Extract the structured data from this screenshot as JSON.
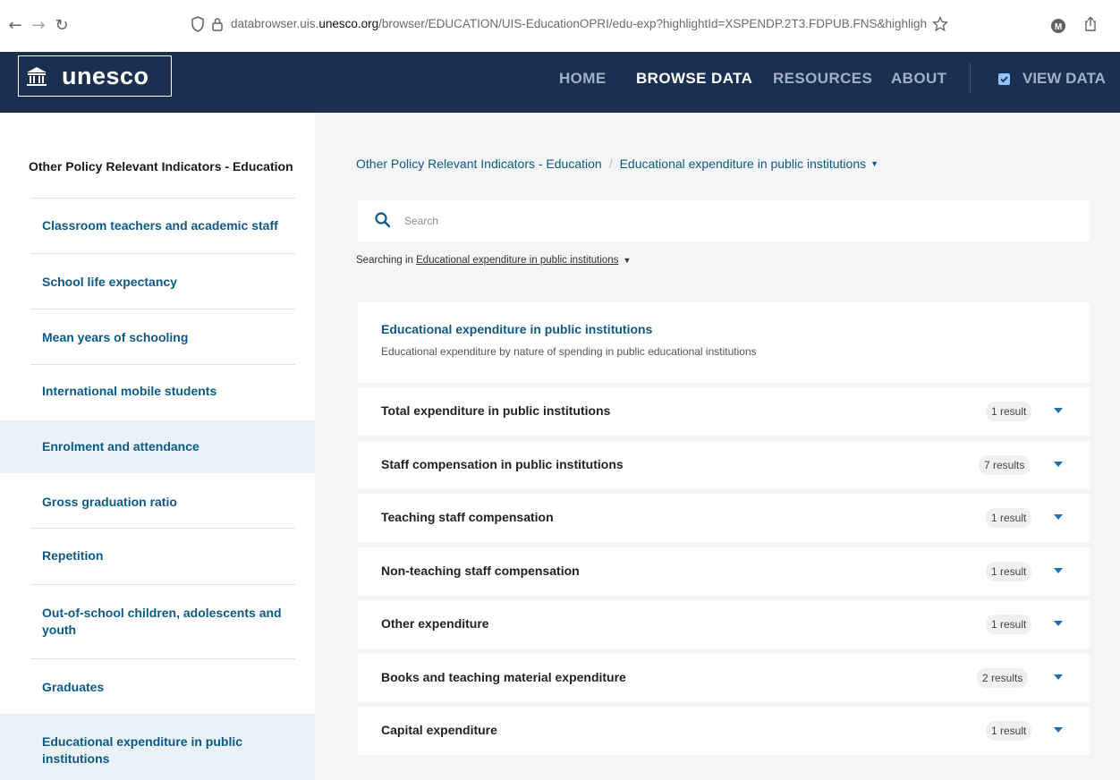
{
  "browser": {
    "url_prefix": "databrowser.uis.",
    "url_host": "unesco.org",
    "url_path": "/browser/EDUCATION/UIS-EducationOPRI/edu-exp?highlightId=XSPENDP.2T3.FDPUB.FNS&highligh",
    "profile_initial": "M"
  },
  "header": {
    "logo_text": "unesco",
    "nav": [
      "HOME",
      "BROWSE DATA",
      "RESOURCES",
      "ABOUT"
    ],
    "view_data": "VIEW DATA"
  },
  "sidebar": {
    "title": "Other Policy Relevant Indicators - Education",
    "items": [
      {
        "label": "Classroom teachers and academic staff"
      },
      {
        "label": "School life expectancy"
      },
      {
        "label": "Mean years of schooling"
      },
      {
        "label": "International mobile students"
      },
      {
        "label": "Enrolment and attendance"
      },
      {
        "label": "Gross graduation ratio"
      },
      {
        "label": "Repetition"
      },
      {
        "label": "Out-of-school children, adolescents and youth"
      },
      {
        "label": "Graduates"
      },
      {
        "label": "Educational expenditure in public institutions"
      }
    ]
  },
  "main": {
    "breadcrumb": {
      "parent": "Other Policy Relevant Indicators - Education",
      "separator": "/",
      "current": "Educational expenditure in public institutions"
    },
    "search": {
      "placeholder": "Search",
      "searching_in_prefix": "Searching in",
      "scope": "Educational expenditure in public institutions"
    },
    "card": {
      "title": "Educational expenditure in public institutions",
      "subtitle": "Educational expenditure by nature of spending in public educational institutions"
    },
    "rows": [
      {
        "label": "Total expenditure in public institutions",
        "badge": "1 result"
      },
      {
        "label": "Staff compensation in public institutions",
        "badge": "7 results"
      },
      {
        "label": "Teaching staff compensation",
        "badge": "1 result"
      },
      {
        "label": "Non-teaching staff compensation",
        "badge": "1 result"
      },
      {
        "label": "Other expenditure",
        "badge": "1 result"
      },
      {
        "label": "Books and teaching material expenditure",
        "badge": "2 results"
      },
      {
        "label": "Capital expenditure",
        "badge": "1 result"
      }
    ]
  }
}
